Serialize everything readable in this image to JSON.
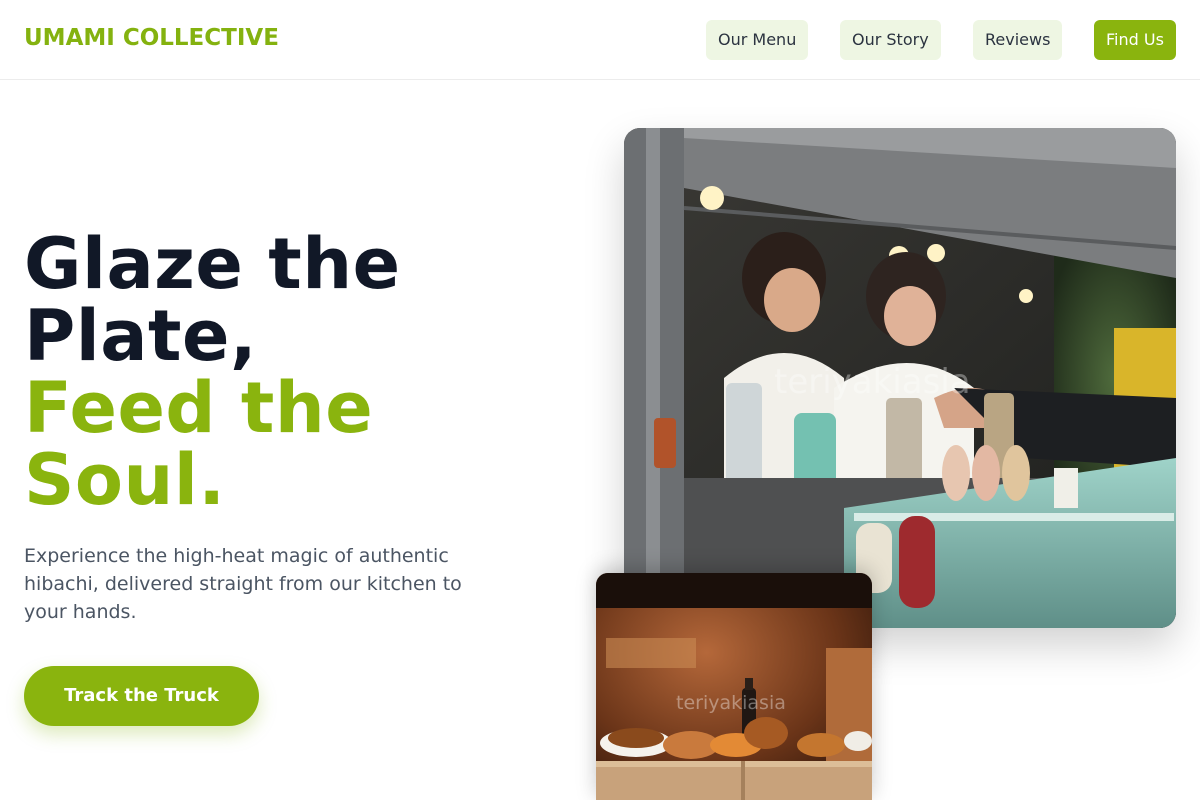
{
  "brand": {
    "logo": "UMAMI COLLECTIVE",
    "accent": "#8ab40e"
  },
  "nav": {
    "items": [
      {
        "label": "Our Menu"
      },
      {
        "label": "Our Story"
      },
      {
        "label": "Reviews"
      },
      {
        "label": "Find Us"
      }
    ]
  },
  "hero": {
    "title_line1": "Glaze the",
    "title_line2": "Plate,",
    "title_line3": "Feed the",
    "title_line4": "Soul.",
    "subtitle": "Experience the high-heat magic of authentic hibachi, delivered straight from our kitchen to your hands.",
    "cta": "Track the Truck"
  },
  "images": {
    "main_watermark": "teriyakiasia",
    "small_watermark": "teriyakiasia"
  }
}
